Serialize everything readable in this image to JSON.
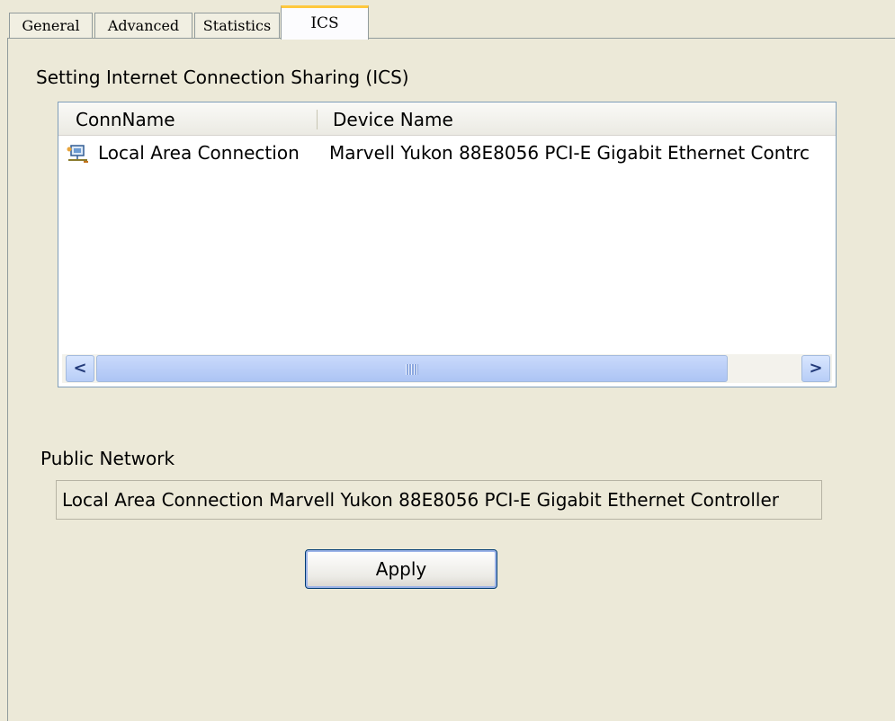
{
  "tabs": [
    {
      "label": "General"
    },
    {
      "label": "Advanced"
    },
    {
      "label": "Statistics"
    },
    {
      "label": "ICS",
      "active": true
    }
  ],
  "ics": {
    "section_title": "Setting Internet Connection Sharing (ICS)",
    "list": {
      "columns": [
        "ConnName",
        "Device Name"
      ],
      "rows": [
        {
          "icon": "network-connection-icon",
          "conn_name": "Local Area Connection",
          "device_name": "Marvell Yukon 88E8056 PCI-E Gigabit Ethernet Contrc"
        }
      ]
    },
    "public_network": {
      "label": "Public Network",
      "value": "Local Area Connection Marvell Yukon 88E8056 PCI-E Gigabit Ethernet Controller"
    },
    "apply_label": "Apply"
  },
  "scrollbar_arrows": {
    "left": "<",
    "right": ">"
  },
  "colors": {
    "panel_bg": "#ece9d8",
    "list_border": "#7f9db9",
    "active_tab_accent": "#ffc83c",
    "scrollbar_blue": "#b7cdf7"
  }
}
